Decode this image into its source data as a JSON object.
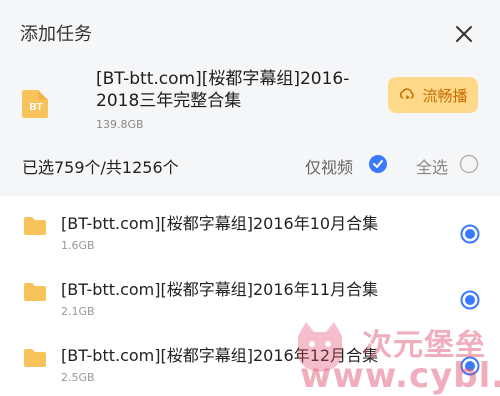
{
  "dialog": {
    "title": "添加任务",
    "task": {
      "badge": "BT",
      "name": "[BT-btt.com][桜都字幕组]2016-2018三年完整合集",
      "size": "139.8GB"
    },
    "stream_button": "流畅播"
  },
  "selection": {
    "summary": "已选759个/共1256个",
    "only_video": "仅视频",
    "select_all": "全选"
  },
  "list": [
    {
      "name": "[BT-btt.com][桜都字幕组]2016年10月合集",
      "size": "1.6GB"
    },
    {
      "name": "[BT-btt.com][桜都字幕组]2016年11月合集",
      "size": "2.1GB"
    },
    {
      "name": "[BT-btt.com][桜都字幕组]2016年12月合集",
      "size": "2.5GB"
    }
  ],
  "colors": {
    "accent": "#3a7afe",
    "folder": "#f7c35a",
    "stream_button_bg": "#ffd98a"
  },
  "watermark": {
    "top": "次元堡垒",
    "bottom": "www.cybl.cc"
  }
}
